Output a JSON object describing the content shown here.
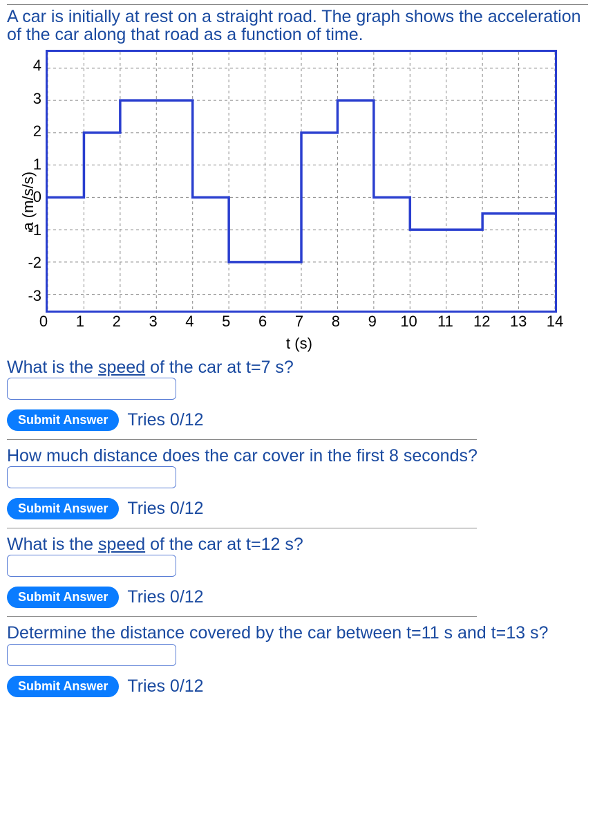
{
  "intro": "A car is initially at rest on a straight road. The graph shows the acceleration of the car along that road as a function of time.",
  "chart_data": {
    "type": "line",
    "xlabel": "t (s)",
    "ylabel": "a (m/s/s)",
    "xlim": [
      0,
      14
    ],
    "ylim": [
      -3.5,
      4.5
    ],
    "xticks": [
      0,
      1,
      2,
      3,
      4,
      5,
      6,
      7,
      8,
      9,
      10,
      11,
      12,
      13,
      14
    ],
    "yticks": [
      -3,
      -2,
      -1,
      0,
      1,
      2,
      3,
      4
    ],
    "series": [
      {
        "name": "acceleration",
        "points": [
          [
            0,
            0
          ],
          [
            1,
            0
          ],
          [
            1,
            2
          ],
          [
            2,
            2
          ],
          [
            2,
            3
          ],
          [
            4,
            3
          ],
          [
            4,
            0
          ],
          [
            5,
            0
          ],
          [
            5,
            -2
          ],
          [
            7,
            -2
          ],
          [
            7,
            2
          ],
          [
            8,
            2
          ],
          [
            8,
            3
          ],
          [
            9,
            3
          ],
          [
            9,
            0
          ],
          [
            10,
            0
          ],
          [
            10,
            -1
          ],
          [
            12,
            -1
          ],
          [
            12,
            -0.5
          ],
          [
            14,
            -0.5
          ]
        ]
      }
    ]
  },
  "questions": [
    {
      "text_a": "What is the ",
      "underline": "speed",
      "text_b": " of the car at t=7 s?",
      "submit": "Submit Answer",
      "tries": "Tries 0/12"
    },
    {
      "text_a": "How much distance does the car cover in the first 8 seconds?",
      "underline": "",
      "text_b": "",
      "submit": "Submit Answer",
      "tries": "Tries 0/12"
    },
    {
      "text_a": "What is the ",
      "underline": "speed",
      "text_b": " of the car at t=12 s?",
      "submit": "Submit Answer",
      "tries": "Tries 0/12"
    },
    {
      "text_a": "Determine the distance covered by the car between t=11 s and t=13 s?",
      "underline": "",
      "text_b": "",
      "submit": "Submit Answer",
      "tries": "Tries 0/12"
    }
  ]
}
